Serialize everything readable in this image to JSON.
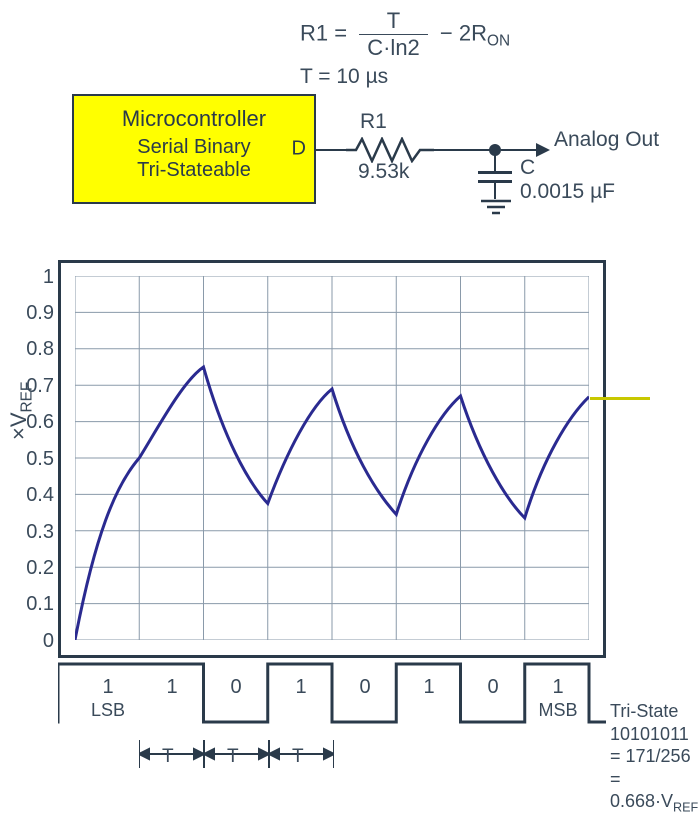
{
  "formula": {
    "lhs": "R1 =",
    "numerator": "T",
    "denominator": "C·ln2",
    "minus": " − 2R",
    "ron_sub": "ON",
    "period": "T = 10 µs"
  },
  "mcu": {
    "title": "Microcontroller",
    "line1": "Serial Binary",
    "line2": "Tri-Stateable",
    "pin": "D"
  },
  "resistor": {
    "name": "R1",
    "value": "9.53k"
  },
  "capacitor": {
    "name": "C",
    "value": "0.0015 µF"
  },
  "output_label": "Analog Out",
  "chart_data": {
    "type": "line",
    "ylabel": "×V_REF",
    "xlabel": "",
    "ylim": [
      0,
      1.0
    ],
    "yticks": [
      0,
      0.1,
      0.2,
      0.3,
      0.4,
      0.5,
      0.6,
      0.7,
      0.8,
      0.9,
      1.0
    ],
    "bit_width_T_us": 10,
    "bits_LSB_first": [
      1,
      1,
      0,
      1,
      0,
      1,
      0,
      1
    ],
    "byte_value": 171,
    "byte_hex": "10101011",
    "final_fraction": 0.668,
    "series": [
      {
        "name": "xVREF",
        "x": [
          0,
          1,
          2,
          3,
          4,
          5,
          6,
          7,
          8
        ],
        "y": [
          0.0,
          0.5,
          0.75,
          0.375,
          0.69,
          0.345,
          0.67,
          0.335,
          0.668
        ]
      }
    ]
  },
  "bit_labels": {
    "values": [
      "1",
      "1",
      "0",
      "1",
      "0",
      "1",
      "0",
      "1"
    ],
    "lsb": "LSB",
    "msb": "MSB",
    "t_marker": "T"
  },
  "tristate": {
    "line1": "Tri-State",
    "line2": "10101011",
    "line3": "= 171/256",
    "line4_prefix": "= 0.668·V",
    "line4_sub": "REF"
  }
}
